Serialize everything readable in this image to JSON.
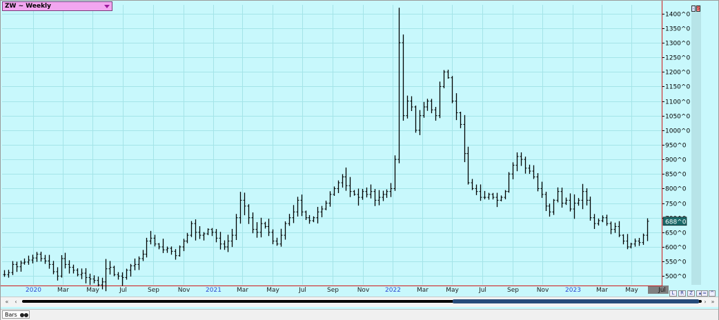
{
  "symbol": {
    "label": "ZW ~ Weekly"
  },
  "price_badge": "688^0",
  "side_buttons": [
    "-",
    "S"
  ],
  "bottom": {
    "tab_label": "Bars"
  },
  "scroll": {
    "left_far": "«",
    "left": "‹",
    "right": "›",
    "right_far": "»"
  },
  "toolbar_buttons": [
    "L",
    "R",
    "Z",
    "▴",
    "≈",
    "^"
  ],
  "colors": {
    "background": "#c8f8fc",
    "grid": "#a4e4e8",
    "bars": "#000000",
    "border": "#d01818",
    "badge": "#1a6a6a"
  },
  "chart_data": {
    "type": "ohlc",
    "frequency": "weekly",
    "ylim": [
      470,
      1430
    ],
    "y_ticks": [
      {
        "v": 500,
        "label": "500^0"
      },
      {
        "v": 550,
        "label": "550^0"
      },
      {
        "v": 600,
        "label": "600^0"
      },
      {
        "v": 650,
        "label": "650^0"
      },
      {
        "v": 700,
        "label": "700^0"
      },
      {
        "v": 750,
        "label": "750^0"
      },
      {
        "v": 800,
        "label": "800^0"
      },
      {
        "v": 850,
        "label": "850^0"
      },
      {
        "v": 900,
        "label": "900^0"
      },
      {
        "v": 950,
        "label": "950^0"
      },
      {
        "v": 1000,
        "label": "1000^0"
      },
      {
        "v": 1050,
        "label": "1050^0"
      },
      {
        "v": 1100,
        "label": "1100^0"
      },
      {
        "v": 1150,
        "label": "1150^0"
      },
      {
        "v": 1200,
        "label": "1200^0"
      },
      {
        "v": 1250,
        "label": "1250^0"
      },
      {
        "v": 1300,
        "label": "1300^0"
      },
      {
        "v": 1350,
        "label": "1350^0"
      },
      {
        "v": 1400,
        "label": "1400^0"
      }
    ],
    "x_ticks": [
      {
        "date": "2020-01",
        "label": "2020",
        "year": true
      },
      {
        "date": "2020-03",
        "label": "Mar"
      },
      {
        "date": "2020-05",
        "label": "May"
      },
      {
        "date": "2020-07",
        "label": "Jul"
      },
      {
        "date": "2020-09",
        "label": "Sep"
      },
      {
        "date": "2020-11",
        "label": "Nov"
      },
      {
        "date": "2021-01",
        "label": "2021",
        "year": true
      },
      {
        "date": "2021-03",
        "label": "Mar"
      },
      {
        "date": "2021-05",
        "label": "May"
      },
      {
        "date": "2021-07",
        "label": "Jul"
      },
      {
        "date": "2021-09",
        "label": "Sep"
      },
      {
        "date": "2021-11",
        "label": "Nov"
      },
      {
        "date": "2022-01",
        "label": "2022",
        "year": true
      },
      {
        "date": "2022-03",
        "label": "Mar"
      },
      {
        "date": "2022-05",
        "label": "May"
      },
      {
        "date": "2022-07",
        "label": "Jul"
      },
      {
        "date": "2022-09",
        "label": "Sep"
      },
      {
        "date": "2022-11",
        "label": "Nov"
      },
      {
        "date": "2023-01",
        "label": "2023",
        "year": true
      },
      {
        "date": "2023-03",
        "label": "Mar"
      },
      {
        "date": "2023-05",
        "label": "May"
      },
      {
        "date": "2023-07",
        "label": "Jul",
        "current": true
      }
    ],
    "last_price": 688,
    "closes_weekly": [
      505,
      512,
      540,
      532,
      545,
      548,
      555,
      562,
      575,
      560,
      552,
      540,
      515,
      500,
      560,
      540,
      530,
      520,
      505,
      510,
      495,
      490,
      485,
      470,
      480,
      525,
      530,
      505,
      500,
      495,
      520,
      535,
      540,
      560,
      575,
      620,
      630,
      610,
      600,
      590,
      595,
      585,
      570,
      600,
      620,
      640,
      680,
      650,
      640,
      645,
      660,
      650,
      630,
      610,
      600,
      620,
      640,
      700,
      760,
      740,
      700,
      660,
      650,
      680,
      670,
      650,
      620,
      610,
      640,
      680,
      700,
      720,
      760,
      720,
      700,
      690,
      700,
      720,
      730,
      750,
      780,
      800,
      820,
      840,
      810,
      790,
      780,
      770,
      790,
      780,
      790,
      760,
      770,
      780,
      790,
      800,
      900,
      1300,
      1050,
      1100,
      1080,
      1000,
      1050,
      1080,
      1100,
      1070,
      1050,
      1150,
      1200,
      1180,
      1100,
      1060,
      1020,
      920,
      820,
      800,
      790,
      770,
      770,
      780,
      770,
      760,
      770,
      790,
      850,
      880,
      910,
      900,
      870,
      860,
      840,
      800,
      780,
      740,
      720,
      760,
      790,
      750,
      760,
      730,
      750,
      760,
      790,
      760,
      700,
      680,
      690,
      700,
      680,
      660,
      670,
      640,
      620,
      600,
      610,
      620,
      615,
      640,
      688
    ]
  }
}
